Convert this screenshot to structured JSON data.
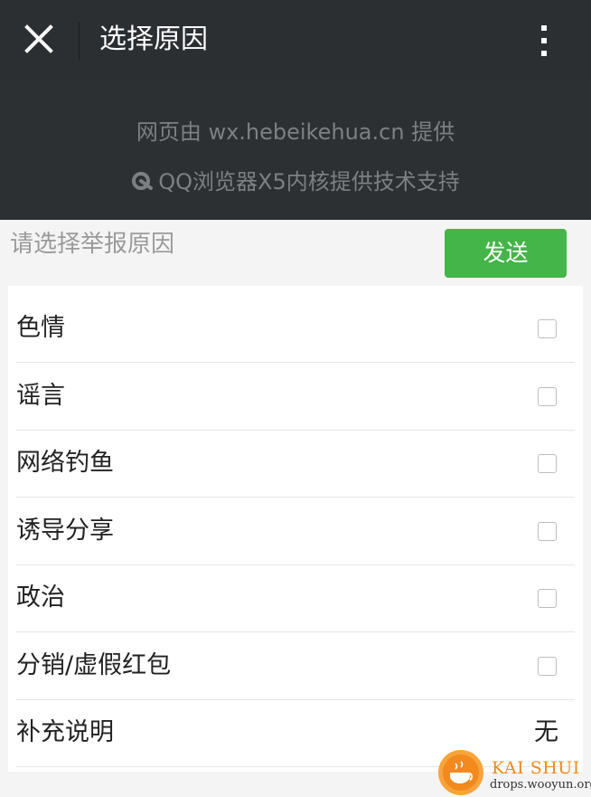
{
  "header": {
    "title": "选择原因",
    "close_icon": "close-icon",
    "more_icon": "more-vertical-icon"
  },
  "provider": {
    "line1": "网页由 wx.hebeikehua.cn 提供",
    "line2": "QQ浏览器X5内核提供技术支持",
    "icon": "qq-browser-icon"
  },
  "report": {
    "prompt": "请选择举报原因",
    "send_label": "发送",
    "reasons": [
      {
        "label": "色情",
        "checked": false
      },
      {
        "label": "谣言",
        "checked": false
      },
      {
        "label": "网络钓鱼",
        "checked": false
      },
      {
        "label": "诱导分享",
        "checked": false
      },
      {
        "label": "政治",
        "checked": false
      },
      {
        "label": "分销/虚假红包",
        "checked": false
      }
    ],
    "supplement": {
      "label": "补充说明",
      "value": "无"
    }
  },
  "watermark": {
    "brand": "KAI SHUI",
    "site": "drops.wooyun.org"
  },
  "colors": {
    "header_bg": "#2b2f32",
    "accent_green": "#44b549",
    "page_bg": "#f4f4f4"
  }
}
